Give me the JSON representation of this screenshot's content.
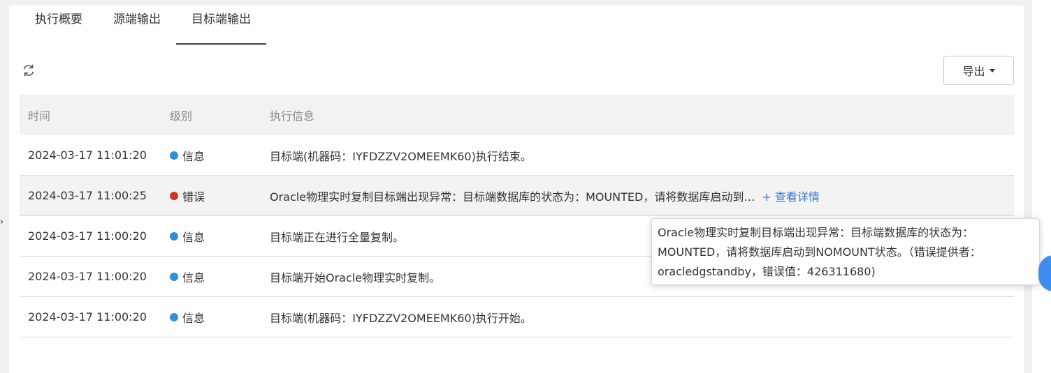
{
  "tabs": [
    {
      "label": "执行概要"
    },
    {
      "label": "源端输出"
    },
    {
      "label": "目标端输出"
    }
  ],
  "toolbar": {
    "refresh_icon": "refresh-icon",
    "export_label": "导出",
    "export_icon": "caret-down-icon"
  },
  "table": {
    "headers": {
      "time": "时间",
      "level": "级别",
      "message": "执行信息"
    },
    "rows": [
      {
        "time": "2024-03-17 11:01:20",
        "level": "信息",
        "level_color": "#2d8fe0",
        "message": "目标端(机器码：IYFDZZV2OMEEMK60)执行结束。",
        "link": ""
      },
      {
        "time": "2024-03-17 11:00:25",
        "level": "错误",
        "level_color": "#d6342a",
        "message": "Oracle物理实时复制目标端出现异常：目标端数据库的状态为：MOUNTED，请将数据库启动到…",
        "link": "+ 查看详情"
      },
      {
        "time": "2024-03-17 11:00:20",
        "level": "信息",
        "level_color": "#2d8fe0",
        "message": "目标端正在进行全量复制。",
        "link": ""
      },
      {
        "time": "2024-03-17 11:00:20",
        "level": "信息",
        "level_color": "#2d8fe0",
        "message": "目标端开始Oracle物理实时复制。",
        "link": ""
      },
      {
        "time": "2024-03-17 11:00:20",
        "level": "信息",
        "level_color": "#2d8fe0",
        "message": "目标端(机器码：IYFDZZV2OMEEMK60)执行开始。",
        "link": ""
      }
    ]
  },
  "tooltip": {
    "text": "Oracle物理实时复制目标端出现异常：目标端数据库的状态为：MOUNTED，请将数据库启动到NOMOUNT状态。（错误提供者：oracledgstandby，错误值：426311680)"
  },
  "colors": {
    "active_tab": "#3a3f63",
    "link": "#3978c4",
    "info": "#2d8fe0",
    "error": "#d6342a"
  }
}
